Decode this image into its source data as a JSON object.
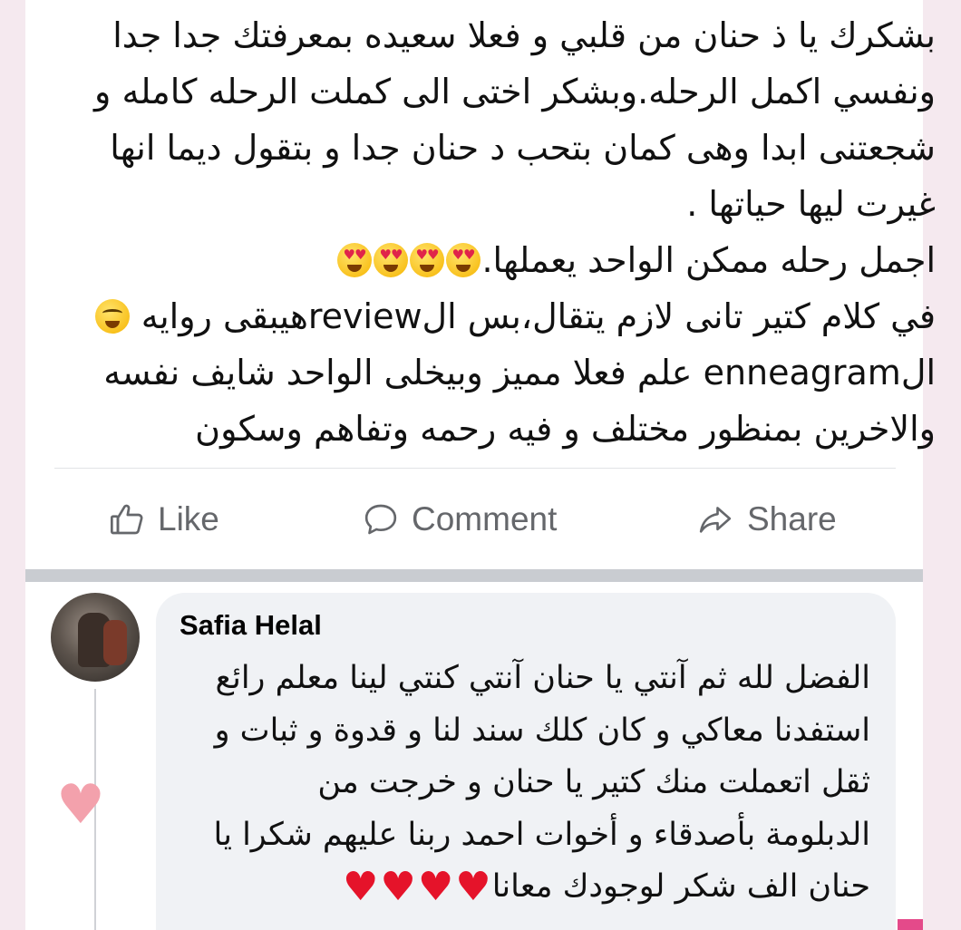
{
  "post": {
    "lines": [
      "بشكرك يا ذ حنان من قلبي و فعلا سعيده بمعرفتك جدا جدا",
      "ونفسي اكمل الرحله.وبشكر اختى الى كملت الرحله كامله و",
      "شجعتنى ابدا وهى كمان بتحب د حنان جدا و بتقول ديما انها",
      "غيرت ليها حياتها .",
      "اجمل رحله ممكن الواحد يعملها.",
      "في كلام كتير تانى لازم يتقال،بس الreviewهيبقى روايه",
      "الenneagram علم فعلا مميز وبيخلى الواحد شايف نفسه",
      "والاخرين بمنظور مختلف و فيه رحمه وتفاهم وسكون"
    ],
    "line5_emoji": "heart-eyes-face x4",
    "line6_emoji": "grinning-face"
  },
  "actions": {
    "like_label": "Like",
    "comment_label": "Comment",
    "share_label": "Share"
  },
  "comment": {
    "author": "Safia Helal",
    "lines": [
      "الفضل لله ثم آنتي يا حنان آنتي كنتي لينا معلم رائع",
      "استفدنا معاكي و كان كلك سند لنا و قدوة و ثبات و",
      "ثقل اتعملت منك كتير يا حنان و خرجت من",
      "الدبلومة بأصدقاء و أخوات احمد ربنا عليهم شكرا يا",
      "حنان الف شكر لوجودك معانا"
    ],
    "last_line_emoji": "red-heart x4",
    "reaction": "heart"
  },
  "colors": {
    "background": "#f5e9ef",
    "card": "#ffffff",
    "action_text": "#65676b",
    "bubble": "#f0f2f5",
    "reaction_heart": "#f3a1ac"
  }
}
